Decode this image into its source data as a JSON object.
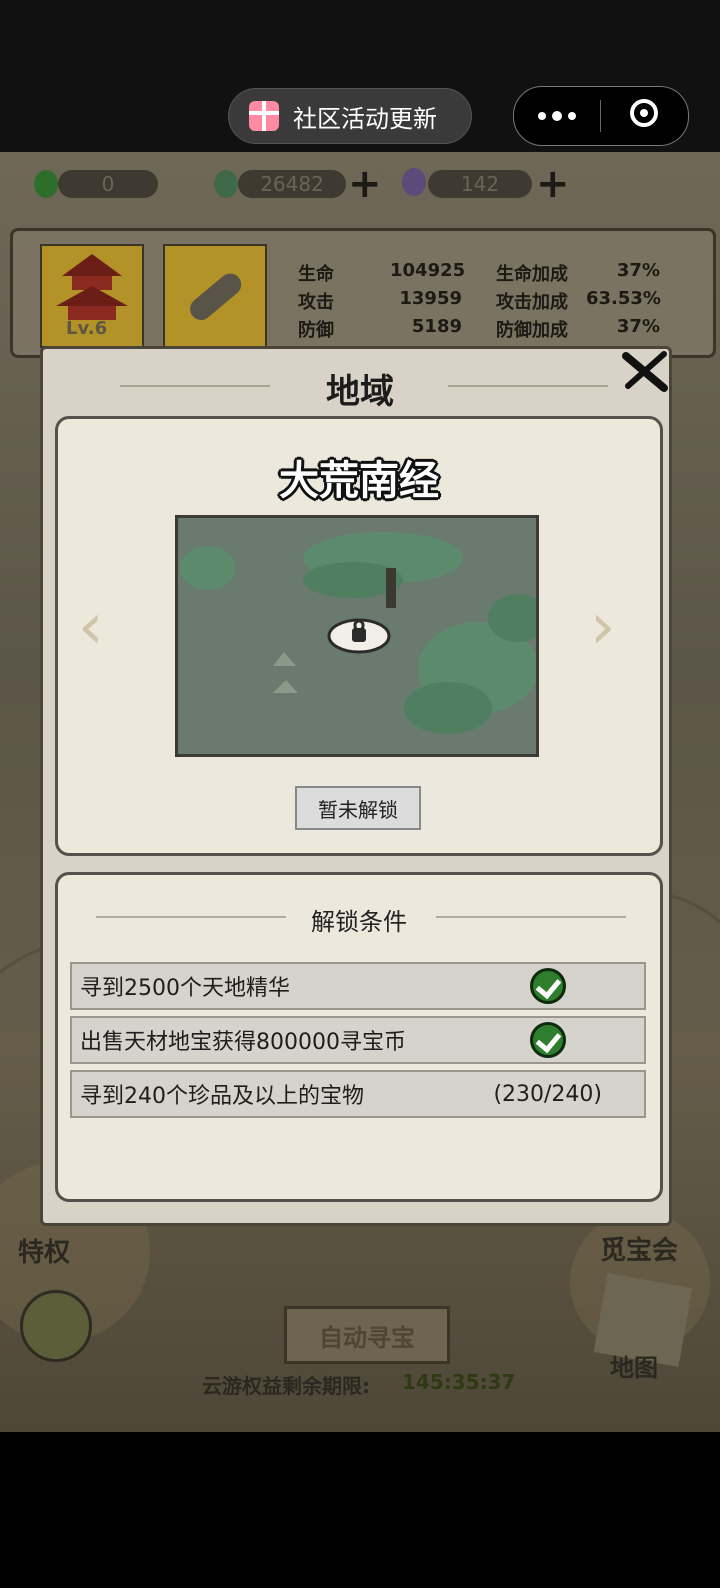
{
  "top_bar": {
    "mini_program_pill": "社区活动更新"
  },
  "resources": {
    "stamina": "0",
    "jade": "26482",
    "gem": "142"
  },
  "stats": {
    "level": "Lv.6",
    "rows": [
      {
        "label": "生命",
        "value": "104925",
        "bonus_label": "生命加成",
        "bonus": "37%"
      },
      {
        "label": "攻击",
        "value": "13959",
        "bonus_label": "攻击加成",
        "bonus": "63.53%"
      },
      {
        "label": "防御",
        "value": "5189",
        "bonus_label": "防御加成",
        "bonus": "37%"
      }
    ]
  },
  "dialog": {
    "title": "地域",
    "region_name": "大荒南经",
    "status_button": "暂未解锁",
    "conditions_title": "解锁条件",
    "conditions": [
      {
        "text": "寻到2500个天地精华",
        "done": true,
        "progress": ""
      },
      {
        "text": "出售天材地宝获得800000寻宝币",
        "done": true,
        "progress": ""
      },
      {
        "text": "寻到240个珍品及以上的宝物",
        "done": false,
        "progress": "(230/240)"
      }
    ]
  },
  "background_ui": {
    "privilege_label": "特权",
    "treasure_label": "觅宝会",
    "auto_button": "自动寻宝",
    "map_label": "地图",
    "timer_label": "云游权益剩余期限:",
    "timer_value": "145:35:37"
  },
  "colors": {
    "check_green": "#2f7e2d",
    "dialog_bg": "#d8d3c6",
    "card_bg": "#ece8dc"
  }
}
